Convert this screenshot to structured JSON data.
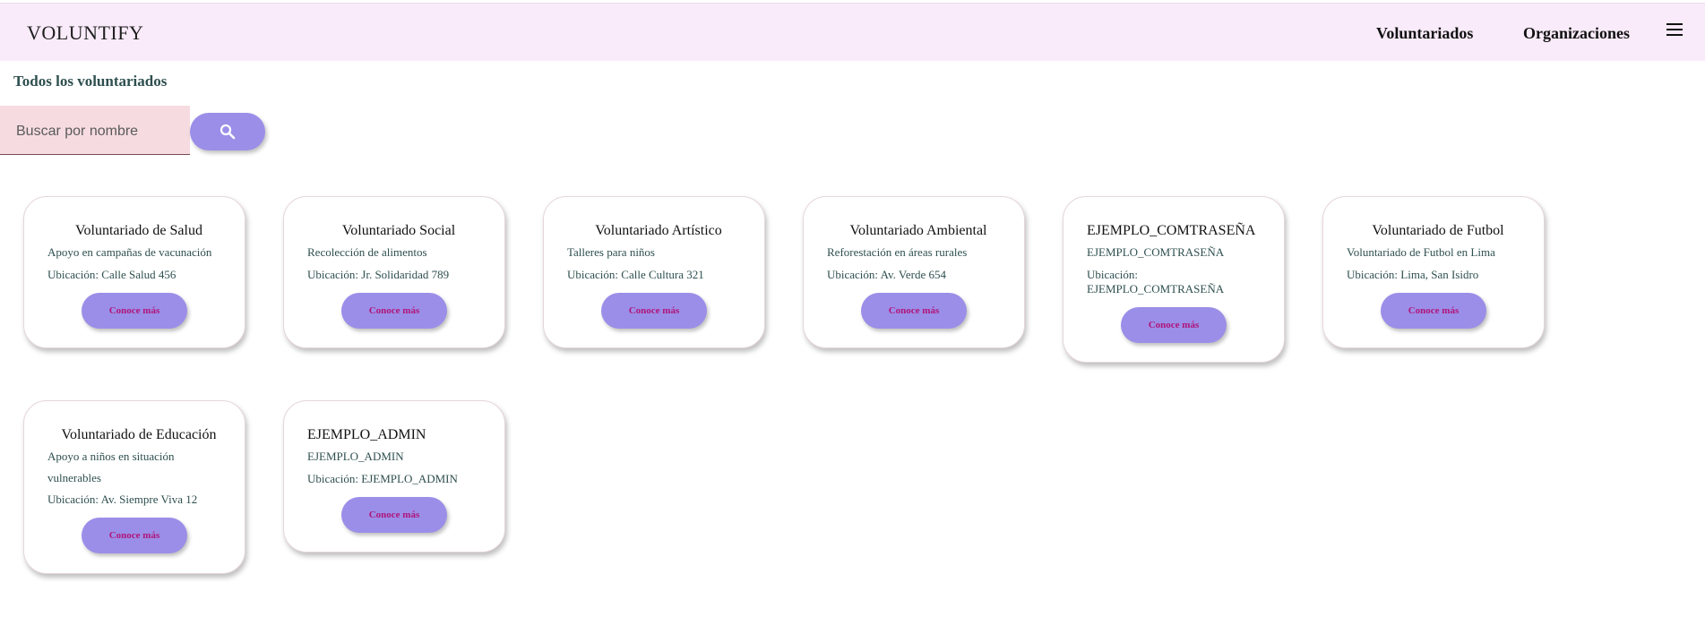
{
  "navbar": {
    "brand": "VOLUNTIFY",
    "links": [
      {
        "label": "Voluntariados"
      },
      {
        "label": "Organizaciones"
      }
    ]
  },
  "page": {
    "title": "Todos los voluntariados"
  },
  "search": {
    "placeholder": "Buscar por nombre",
    "value": ""
  },
  "cards": [
    {
      "title": "Voluntariado de Salud",
      "description": "Apoyo en campañas de vacunación",
      "location": "Ubicación: Calle Salud 456",
      "button": "Conoce más"
    },
    {
      "title": "Voluntariado Social",
      "description": "Recolección de alimentos",
      "location": "Ubicación: Jr. Solidaridad 789",
      "button": "Conoce más"
    },
    {
      "title": "Voluntariado Artístico",
      "description": "Talleres para niños",
      "location": "Ubicación: Calle Cultura 321",
      "button": "Conoce más"
    },
    {
      "title": "Voluntariado Ambiental",
      "description": "Reforestación en áreas rurales",
      "location": "Ubicación: Av. Verde 654",
      "button": "Conoce más"
    },
    {
      "title": "EJEMPLO_COMTRASEÑA",
      "description": "EJEMPLO_COMTRASEÑA",
      "location": "Ubicación: EJEMPLO_COMTRASEÑA",
      "button": "Conoce más"
    },
    {
      "title": "Voluntariado de Futbol",
      "description": "Voluntariado de Futbol en Lima",
      "location": "Ubicación: Lima, San Isidro",
      "button": "Conoce más"
    },
    {
      "title": "Voluntariado de Educación",
      "description": "Apoyo a niños en situación vulnerables",
      "location": "Ubicación: Av. Siempre Viva 12",
      "button": "Conoce más"
    },
    {
      "title": "EJEMPLO_ADMIN",
      "description": "EJEMPLO_ADMIN",
      "location": "Ubicación: EJEMPLO_ADMIN",
      "button": "Conoce más"
    }
  ],
  "colors": {
    "navbar_bg": "#f9ebf9",
    "accent_button": "#9b8ee8",
    "button_text": "#b0157a",
    "search_bg": "#f6dce0"
  }
}
